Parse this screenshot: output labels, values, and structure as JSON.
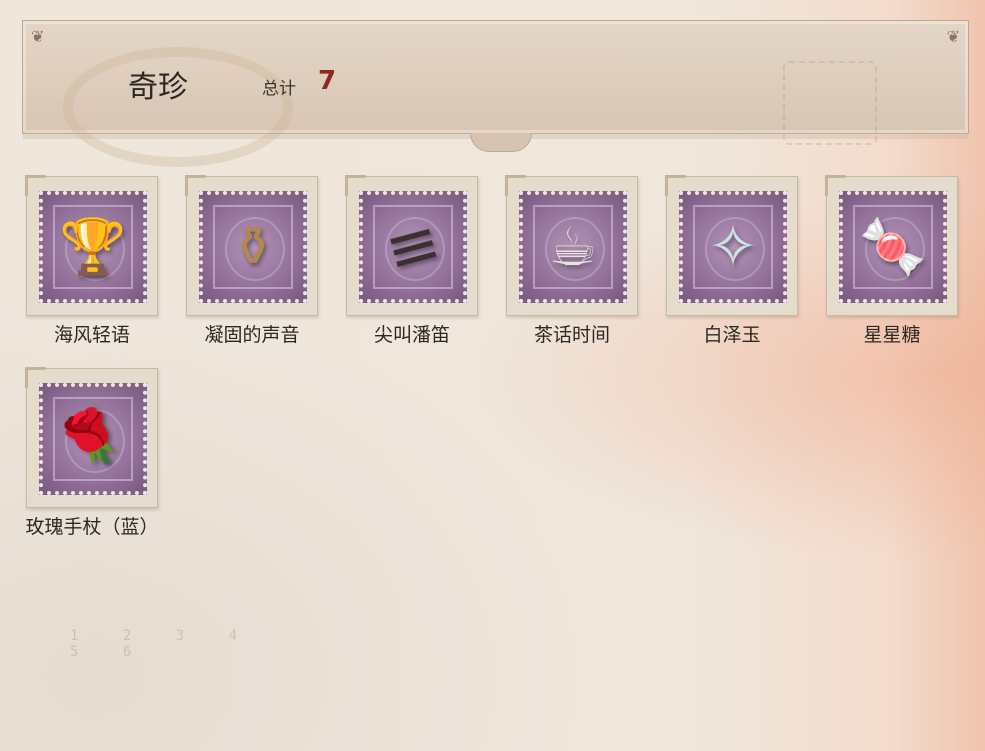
{
  "header": {
    "title": "奇珍",
    "total_label": "总计",
    "total_value": "7"
  },
  "items": [
    {
      "name": "海风轻语",
      "icon": "crystal-goblet-icon",
      "glyph": "🏆",
      "color": "#6fd3f0"
    },
    {
      "name": "凝固的声音",
      "icon": "bronze-urn-icon",
      "glyph": "⚱",
      "color": "#b08850"
    },
    {
      "name": "尖叫潘笛",
      "icon": "pan-flute-icon",
      "glyph": "≡",
      "color": "#3a3030"
    },
    {
      "name": "茶话时间",
      "icon": "teapot-icon",
      "glyph": "☕",
      "color": "#e8e4de"
    },
    {
      "name": "白泽玉",
      "icon": "jade-deer-icon",
      "glyph": "✧",
      "color": "#c9e4e4"
    },
    {
      "name": "星星糖",
      "icon": "candy-jar-icon",
      "glyph": "🍬",
      "color": "#f2b2c8"
    },
    {
      "name": "玫瑰手杖（蓝）",
      "icon": "blue-rose-cane-icon",
      "glyph": "🌹",
      "color": "#2a4fc8"
    }
  ],
  "decor": {
    "ruler_text": "1 2 3 4 5 6"
  }
}
